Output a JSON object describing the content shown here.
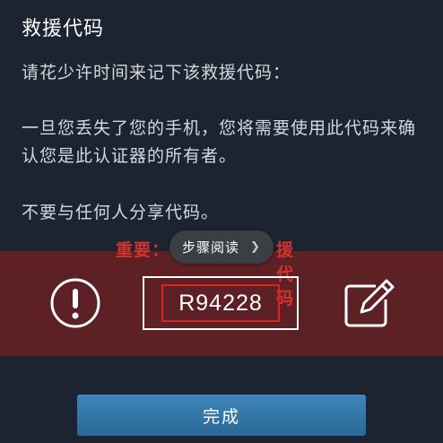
{
  "page_title": "救援代码",
  "instruction": "请花少许时间来记下该救援代码：",
  "lost_phone_message": "一旦您丢失了您的手机，您将需要使用此代码来确认您是此认证器的所有者。",
  "dont_share": "不要与任何人分享代码。",
  "warning": {
    "prefix": "重要：",
    "suffix": "援代码"
  },
  "tooltip": {
    "label": "步骤阅读",
    "icon": "chevron-right-icon"
  },
  "rescue_code": "R94228",
  "icons": {
    "alert": "exclamation-circle-icon",
    "edit": "edit-pencil-icon"
  },
  "done_button_label": "完成",
  "colors": {
    "background": "#1c2431",
    "warning_band": "#5c2025",
    "warning_text": "#d4322e",
    "code_highlight": "#d9251e",
    "button": "#3479aa"
  }
}
